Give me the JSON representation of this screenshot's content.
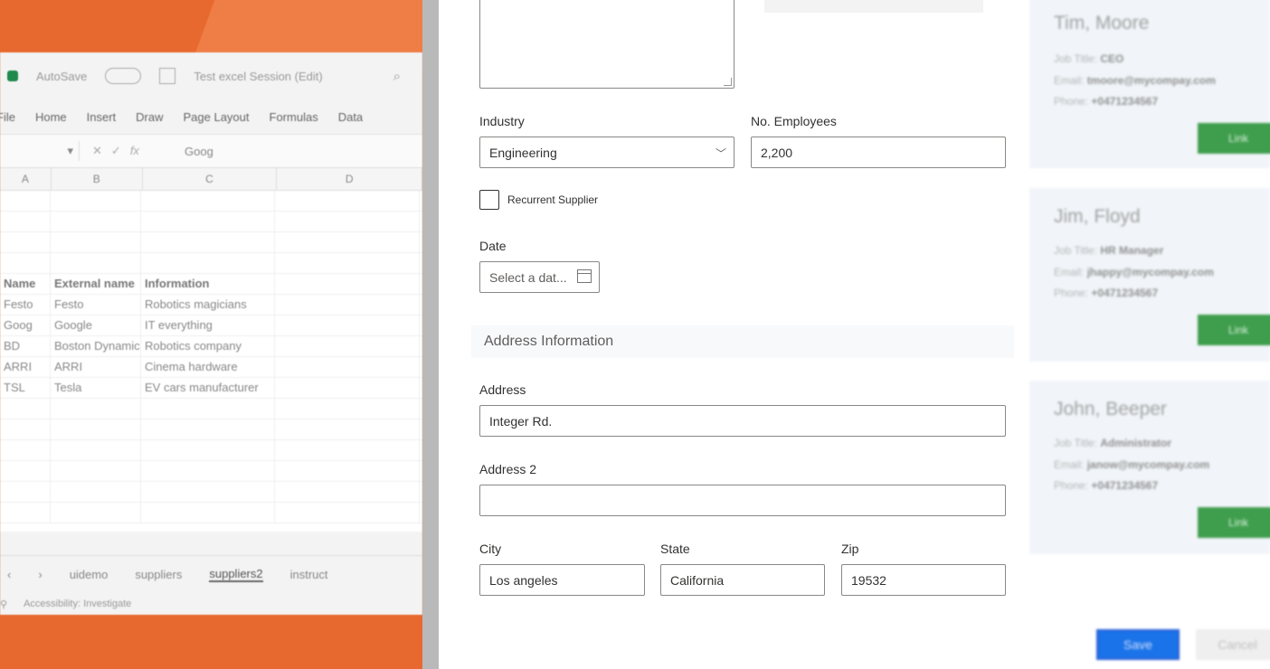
{
  "excel": {
    "autosave": "AutoSave",
    "title": "Test excel Session (Edit)",
    "ribbon": [
      "File",
      "Home",
      "Insert",
      "Draw",
      "Page Layout",
      "Formulas",
      "Data"
    ],
    "formula_value": "Goog",
    "columns": [
      "A",
      "B",
      "C",
      "D"
    ],
    "table": {
      "headers": [
        "Name",
        "External name",
        "Information"
      ],
      "rows": [
        [
          "Festo",
          "Festo",
          "Robotics magicians"
        ],
        [
          "Goog",
          "Google",
          "IT everything"
        ],
        [
          "BD",
          "Boston Dynamics",
          "Robotics company"
        ],
        [
          "ARRI",
          "ARRI",
          "Cinema hardware"
        ],
        [
          "TSL",
          "Tesla",
          "EV cars manufacturer"
        ]
      ]
    },
    "sheets": [
      "uidemo",
      "suppliers",
      "suppliers2",
      "instruct"
    ],
    "status": "Accessibility: Investigate"
  },
  "form": {
    "industry_label": "Industry",
    "industry_value": "Engineering",
    "employees_label": "No. Employees",
    "employees_value": "2,200",
    "recurrent_label": "Recurrent Supplier",
    "date_label": "Date",
    "date_placeholder": "Select a dat...",
    "section_title": "Address Information",
    "address_label": "Address",
    "address_value": "Integer Rd.",
    "address2_label": "Address 2",
    "address2_value": "",
    "city_label": "City",
    "city_value": "Los angeles",
    "state_label": "State",
    "state_value": "California",
    "zip_label": "Zip",
    "zip_value": "19532"
  },
  "contacts": [
    {
      "name": "Tim, Moore",
      "job": "CEO",
      "email": "tmoore@mycompay.com",
      "phone": "+0471234567",
      "action": "Link"
    },
    {
      "name": "Jim, Floyd",
      "job": "HR Manager",
      "email": "jhappy@mycompay.com",
      "phone": "+0471234567",
      "action": "Link"
    },
    {
      "name": "John, Beeper",
      "job": "Administrator",
      "email": "janow@mycompay.com",
      "phone": "+0471234567",
      "action": "Link"
    }
  ],
  "contact_labels": {
    "job": "Job Title:",
    "email": "Email:",
    "phone": "Phone:"
  },
  "actions": {
    "save": "Save",
    "cancel": "Cancel"
  }
}
